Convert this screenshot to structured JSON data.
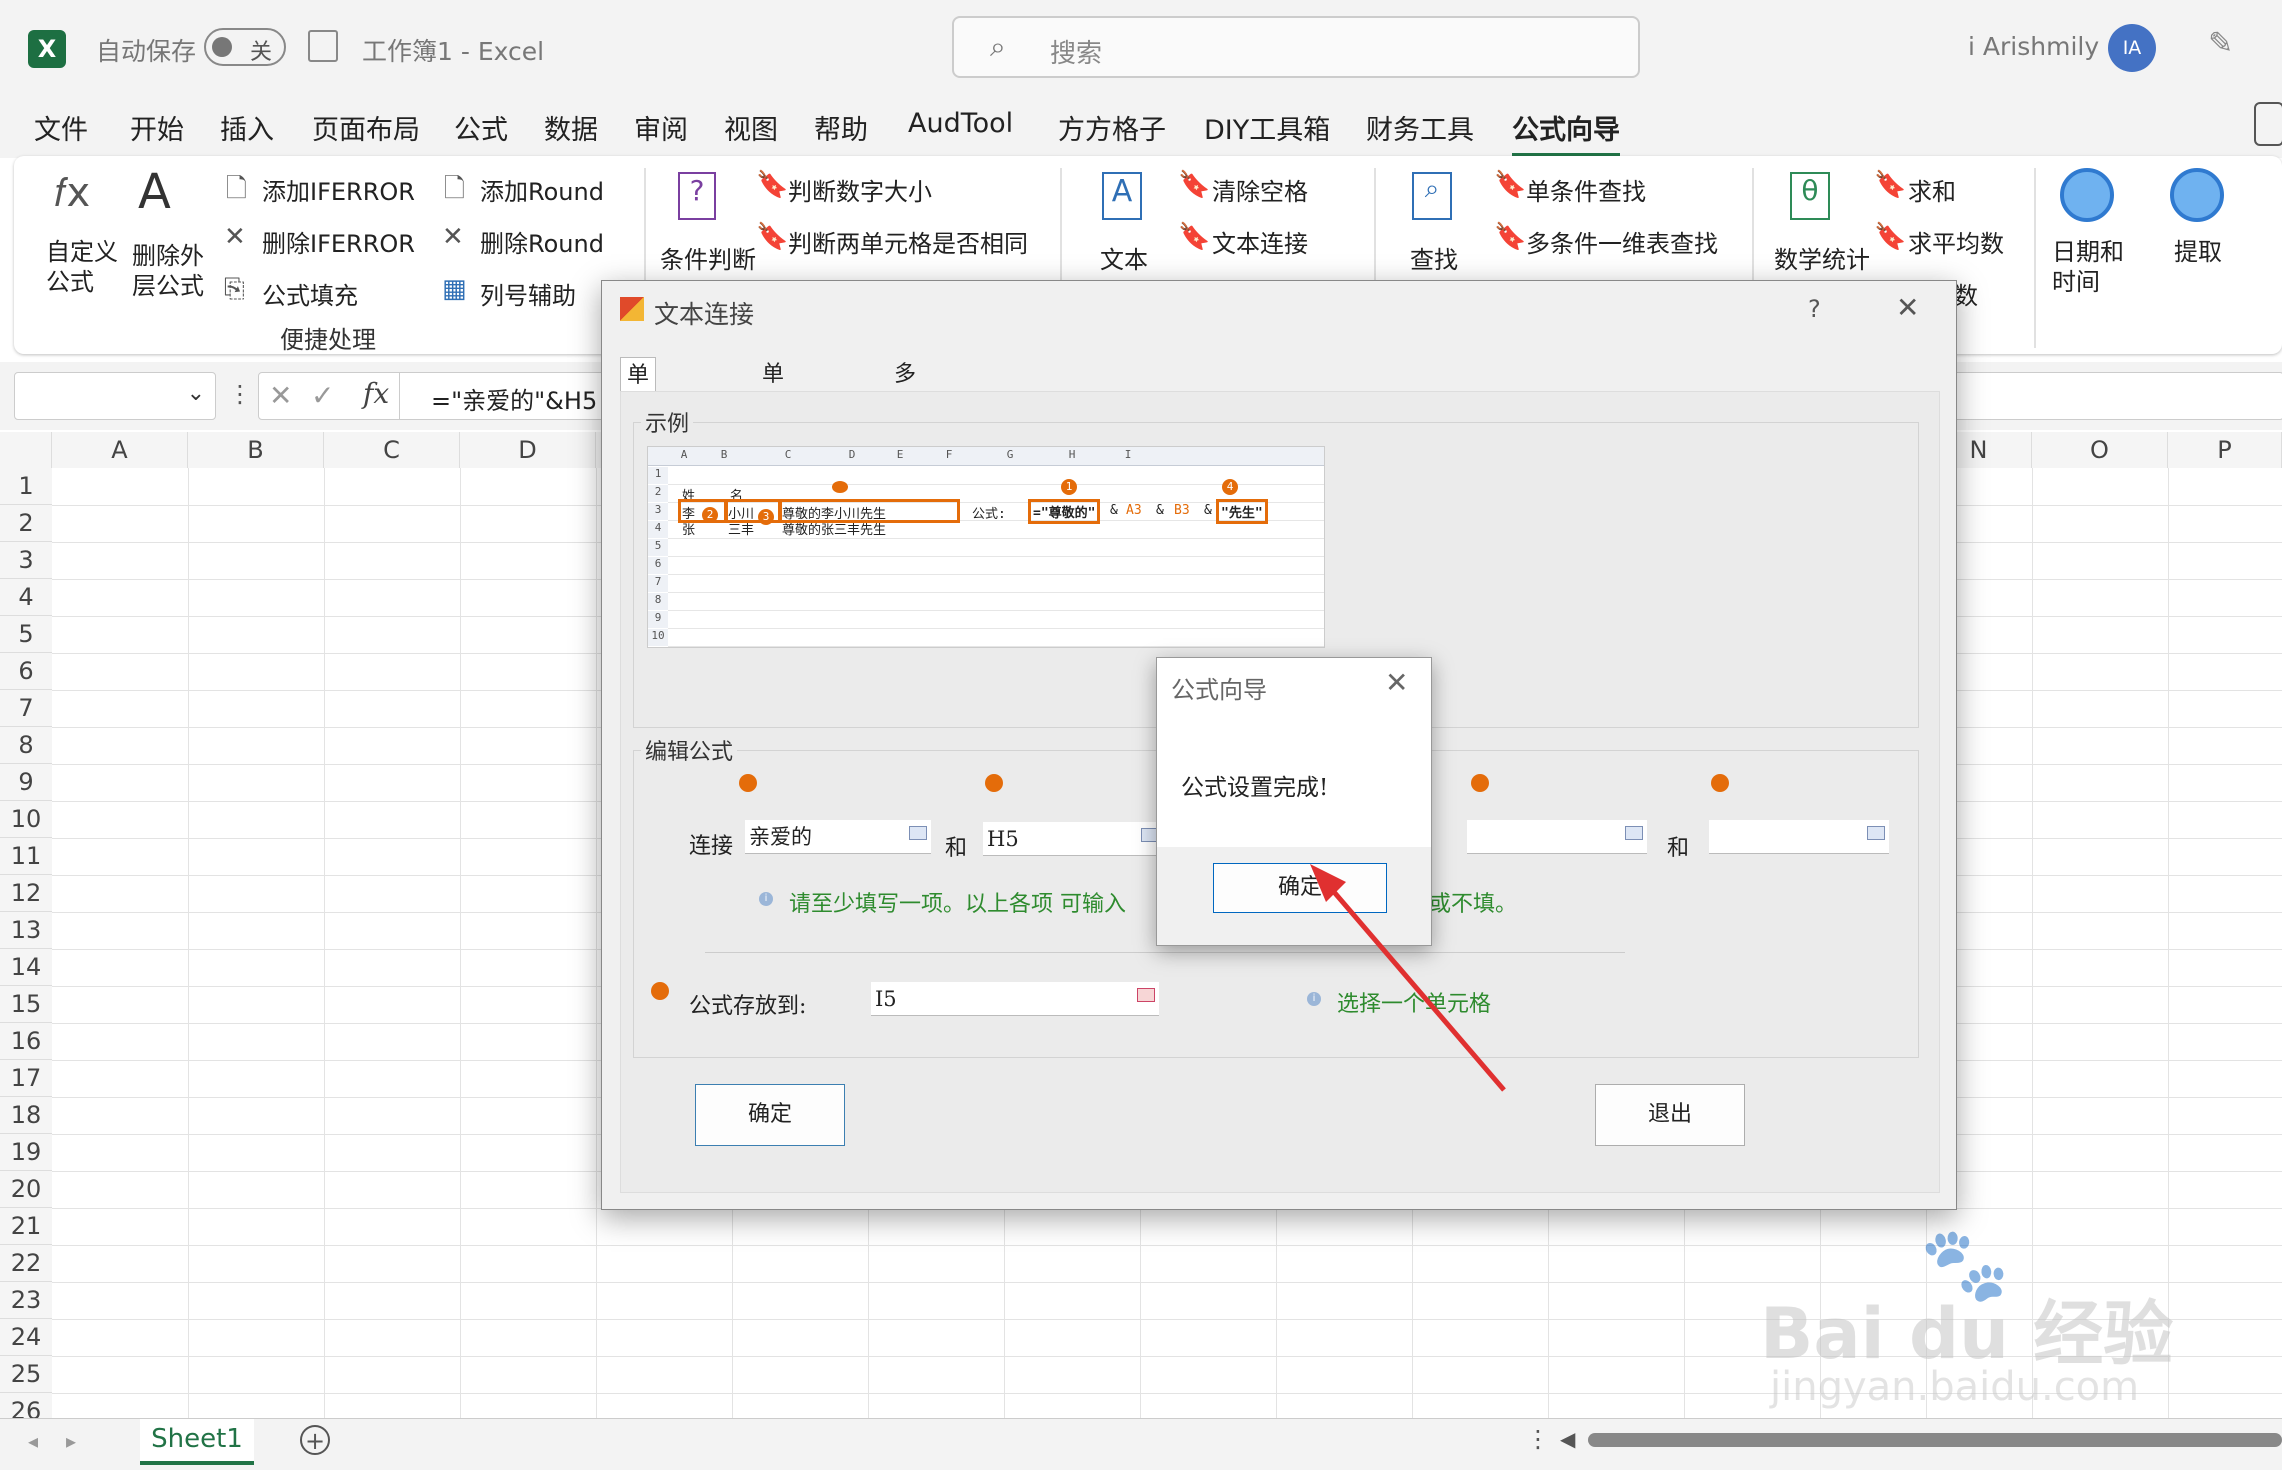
{
  "titlebar": {
    "autosave_label": "自动保存",
    "autosave_state": "关",
    "doc_title": "工作簿1  -  Excel",
    "search_placeholder": "搜索",
    "user_name": "i Arishmily",
    "avatar_initials": "IA"
  },
  "menu": [
    "文件",
    "开始",
    "插入",
    "页面布局",
    "公式",
    "数据",
    "审阅",
    "视图",
    "帮助",
    "AudTool",
    "方方格子",
    "DIY工具箱",
    "财务工具",
    "公式向导"
  ],
  "menu_active": "公式向导",
  "ribbon": {
    "custom_formula": [
      "自定义",
      "公式"
    ],
    "delete_external": [
      "删除外",
      "层公式"
    ],
    "add_iferror": "添加IFERROR",
    "del_iferror": "删除IFERROR",
    "fill_formula": "公式填充",
    "add_round": "添加Round",
    "del_round": "删除Round",
    "col_helper": "列号辅助",
    "group_label": "便捷处理",
    "cond_judge": "条件判断",
    "judge_num": "判断数字大小",
    "judge_two": "判断两单元格是否相同",
    "text": "文本",
    "clear_space": "清除空格",
    "text_concat": "文本连接",
    "find": "查找",
    "single_find": "单条件查找",
    "multi_find": "多条件一维表查找",
    "math_stat": "数学统计",
    "sum": "求和",
    "average": "求平均数",
    "count_partial": "数",
    "date_time": [
      "日期和",
      "时间"
    ],
    "extract": "提取"
  },
  "formula_bar": {
    "formula": "=\"亲爱的\"&H5"
  },
  "grid": {
    "columns": [
      "A",
      "B",
      "C",
      "D",
      "N",
      "O",
      "P"
    ],
    "rows": [
      "1",
      "2",
      "3",
      "4",
      "5",
      "6",
      "7",
      "8",
      "9",
      "10",
      "11",
      "12",
      "13",
      "14",
      "15",
      "16",
      "17",
      "18",
      "19",
      "20",
      "21",
      "22",
      "23",
      "24",
      "25",
      "26"
    ]
  },
  "sheet_tab": "Sheet1",
  "dialog": {
    "title": "文本连接",
    "help": "?",
    "tabs": [
      "单元格文本",
      "单区域文本",
      "多区域文本"
    ],
    "example_label": "示例",
    "edit_label": "编辑公式",
    "concat_label": "连接",
    "and_label": "和",
    "field1": "亲爱的",
    "field2": "H5",
    "field3": "",
    "field4": "",
    "hint1": "请至少填写一项。以上各项 可输入",
    "hint1_tail": "或不填。",
    "store_label": "公式存放到:",
    "store_value": "I5",
    "hint2": "选择一个单元格",
    "ok": "确定",
    "exit": "退出",
    "sample": {
      "cols": [
        "A",
        "B",
        "C",
        "D",
        "E",
        "F",
        "G",
        "H",
        "I"
      ],
      "rows": [
        "1",
        "2",
        "3",
        "4",
        "5",
        "6",
        "7",
        "8",
        "9",
        "10"
      ],
      "r2a": "姓",
      "r2b": "名",
      "r3a": "李",
      "r3b": "小川",
      "r3c": "尊敬的李小川先生",
      "r4a": "张",
      "r4b": "三丰",
      "r4c": "尊敬的张三丰先生",
      "formula_label": "公式:",
      "f_part1": "=\"尊敬的\"",
      "f_amp": "&",
      "f_a3": "A3",
      "f_b3": "B3",
      "f_part2": "\"先生\"",
      "markers": [
        "1",
        "2",
        "3",
        "4"
      ]
    }
  },
  "msgbox": {
    "title": "公式向导",
    "message": "公式设置完成!",
    "ok": "确定"
  },
  "watermark": {
    "brand": "Bai du 经验",
    "url": "jingyan.baidu.com"
  },
  "colors": {
    "excel_green": "#217346",
    "orange": "#e46c0a",
    "hint_green": "#2e8b2e",
    "arrow_red": "#e03030"
  }
}
